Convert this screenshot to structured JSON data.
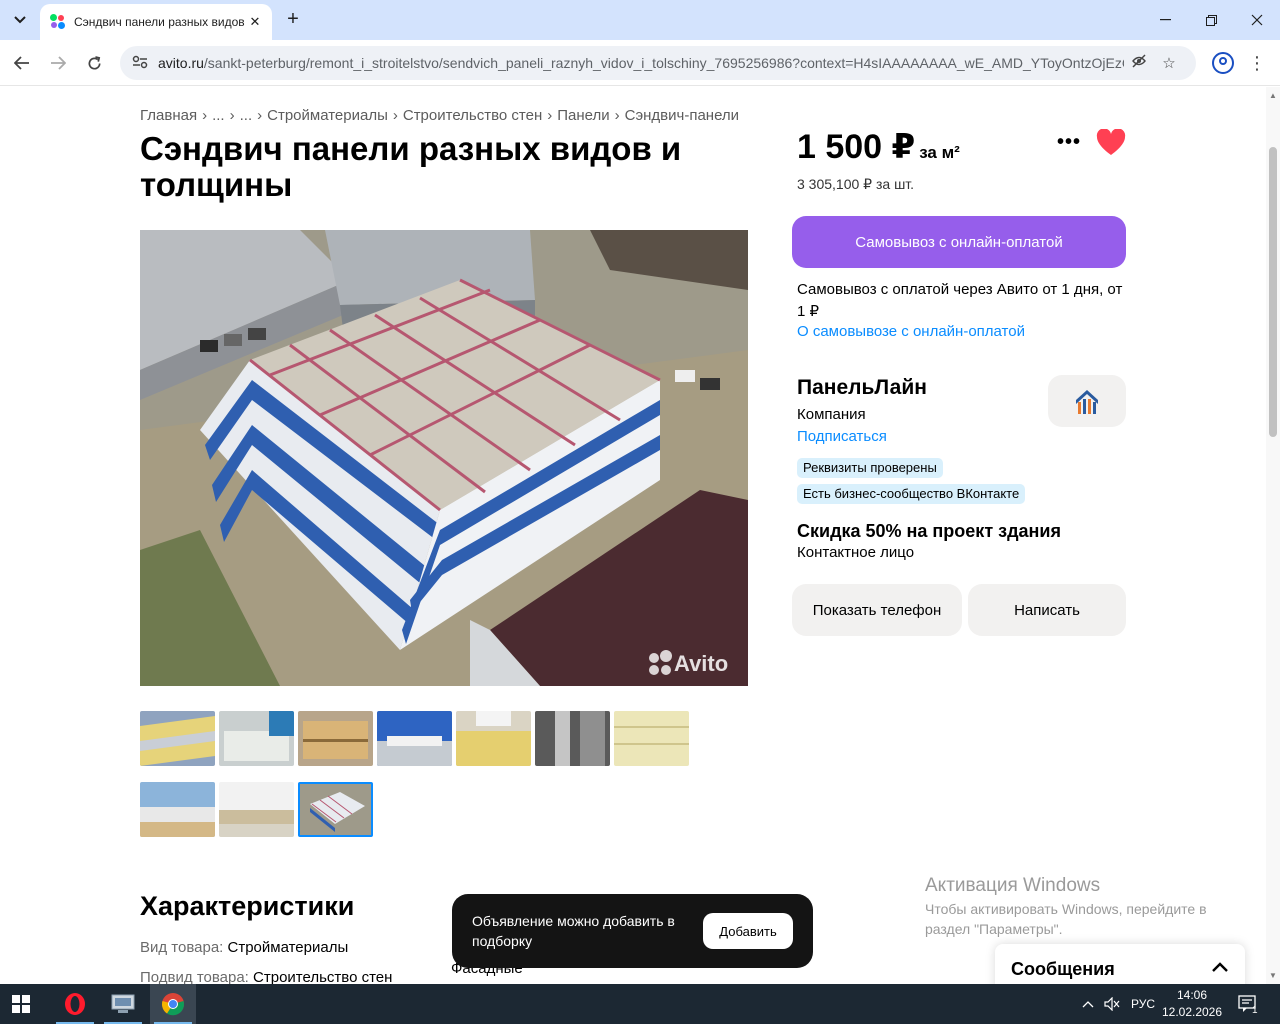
{
  "browser": {
    "tab_title": "Сэндвич панели разных видов",
    "url_host": "avito.ru",
    "url_path": "/sankt-peterburg/remont_i_stroitelstvo/sendvich_paneli_raznyh_vidov_i_tolschiny_7695256986?context=H4sIAAAAAAAA_wE_AMD_YToyOntzOjEzOi...",
    "new_tab_label": "+"
  },
  "breadcrumb": [
    "Главная",
    "...",
    "...",
    "Стройматериалы",
    "Строительство стен",
    "Панели",
    "Сэндвич-панели"
  ],
  "listing": {
    "title": "Сэндвич панели разных видов и толщины",
    "price": "1 500 ₽",
    "price_unit": "за м²",
    "price_per_item": "3 305,100 ₽ за шт.",
    "photo_watermark": "Avito"
  },
  "delivery": {
    "button_label": "Самовывоз с онлайн-оплатой",
    "description": "Самовывоз с оплатой через Авито от 1 дня, от 1 ₽",
    "link": "О самовывозе с онлайн-оплатой"
  },
  "seller": {
    "name": "ПанельЛайн",
    "type": "Компания",
    "subscribe": "Подписаться",
    "badges": [
      "Реквизиты проверены",
      "Есть бизнес-сообщество ВКонтакте"
    ],
    "promo": "Скидка 50% на проект здания",
    "contact": "Контактное лицо",
    "phone_button": "Показать телефон",
    "write_button": "Написать"
  },
  "characteristics": {
    "title": "Характеристики",
    "rows": [
      {
        "key": "Вид товара: ",
        "value": "Стройматериалы"
      },
      {
        "key": "Подвид товара: ",
        "value": "Строительство стен"
      }
    ],
    "right_value": "Фасадные"
  },
  "toast": {
    "text": "Объявление можно добавить в подборку",
    "button": "Добавить"
  },
  "windows_activation": {
    "heading": "Активация Windows",
    "line1": "Чтобы активировать Windows, перейдите в",
    "line2": "раздел \"Параметры\"."
  },
  "messages": {
    "label": "Сообщения"
  },
  "taskbar": {
    "lang": "РУС",
    "time": "14:06",
    "date": "12.02.2026",
    "notif_count": "1"
  },
  "colors": {
    "accent_purple": "#965eeb",
    "link_blue": "#0a8cff",
    "badge_blue": "#d9f0fc",
    "favorite_red": "#ff4053"
  }
}
